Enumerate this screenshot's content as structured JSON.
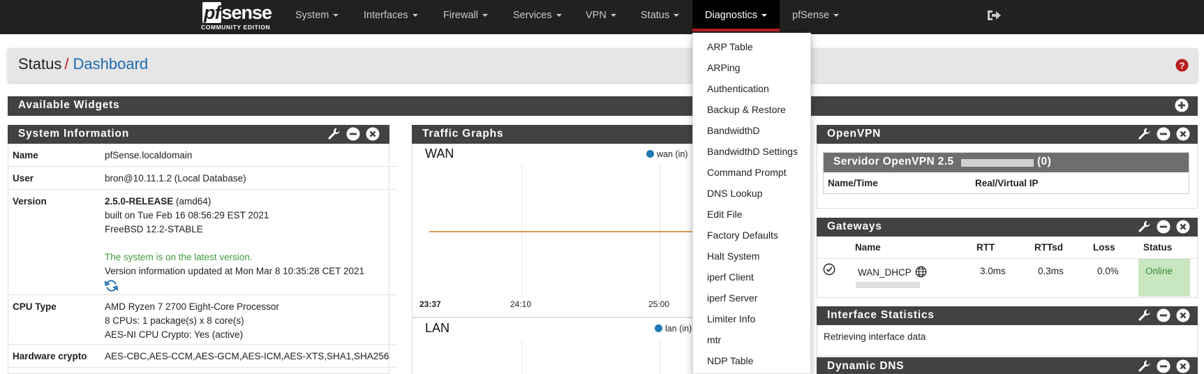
{
  "navbar": {
    "logo_word_pf": "pf",
    "logo_word_rest": "sense",
    "logo_tagline": "COMMUNITY EDITION",
    "items": [
      {
        "label": "System"
      },
      {
        "label": "Interfaces"
      },
      {
        "label": "Firewall"
      },
      {
        "label": "Services"
      },
      {
        "label": "VPN"
      },
      {
        "label": "Status"
      },
      {
        "label": "Diagnostics"
      },
      {
        "label": "pfSense"
      }
    ],
    "active_item": "Diagnostics",
    "accent_color": "#b71c1c"
  },
  "breadcrumb": {
    "section": "Status",
    "separator": "/",
    "page": "Dashboard"
  },
  "available_widgets": {
    "title": "Available Widgets"
  },
  "system_info": {
    "title": "System Information",
    "rows": [
      {
        "label": "Name",
        "lines": [
          "pfSense.localdomain"
        ]
      },
      {
        "label": "User",
        "lines": [
          "bron@10.11.1.2 (Local Database)"
        ]
      },
      {
        "label": "Version",
        "version_bold": "2.5.0-RELEASE",
        "version_arch": " (amd64)",
        "built": "built on Tue Feb 16 08:56:29 EST 2021",
        "os": "FreeBSD 12.2-STABLE",
        "update_status": "The system is on the latest version.",
        "updated_at": "Version information updated at Mon Mar 8 10:35:28 CET 2021"
      },
      {
        "label": "CPU Type",
        "lines": [
          "AMD Ryzen 7 2700 Eight-Core Processor",
          "8 CPUs: 1 package(s) x 8 core(s)",
          "AES-NI CPU Crypto: Yes (active)"
        ]
      },
      {
        "label": "Hardware crypto",
        "lines": [
          "AES-CBC,AES-CCM,AES-GCM,AES-ICM,AES-XTS,SHA1,SHA256"
        ]
      }
    ]
  },
  "traffic_graphs": {
    "title": "Traffic Graphs",
    "wan": {
      "title": "WAN",
      "legend": "wan (in)",
      "ticks": [
        "23:37",
        "24:10",
        "25:00"
      ]
    },
    "lan": {
      "title": "LAN",
      "legend": "lan (in)"
    },
    "series_color": "#1f77b4",
    "line_color": "#d9a050"
  },
  "diagnostics_menu": [
    "ARP Table",
    "ARPing",
    "Authentication",
    "Backup & Restore",
    "BandwidthD",
    "BandwidthD Settings",
    "Command Prompt",
    "DNS Lookup",
    "Edit File",
    "Factory Defaults",
    "Halt System",
    "iperf Client",
    "iperf Server",
    "Limiter Info",
    "mtr",
    "NDP Table"
  ],
  "openvpn": {
    "title": "OpenVPN",
    "server_name": "Servidor OpenVPN 2.5",
    "server_count": "(0)",
    "col_name_time": "Name/Time",
    "col_ip": "Real/Virtual IP"
  },
  "gateways": {
    "title": "Gateways",
    "columns": [
      "Name",
      "RTT",
      "RTTsd",
      "Loss",
      "Status"
    ],
    "rows": [
      {
        "name": "WAN_DHCP",
        "rtt": "3.0ms",
        "rttsd": "0.3ms",
        "loss": "0.0%",
        "status": "Online"
      }
    ],
    "online_color": "#c8e6c0"
  },
  "interface_stats": {
    "title": "Interface Statistics",
    "message": "Retrieving interface data"
  },
  "dynamic_dns": {
    "title": "Dynamic DNS"
  }
}
